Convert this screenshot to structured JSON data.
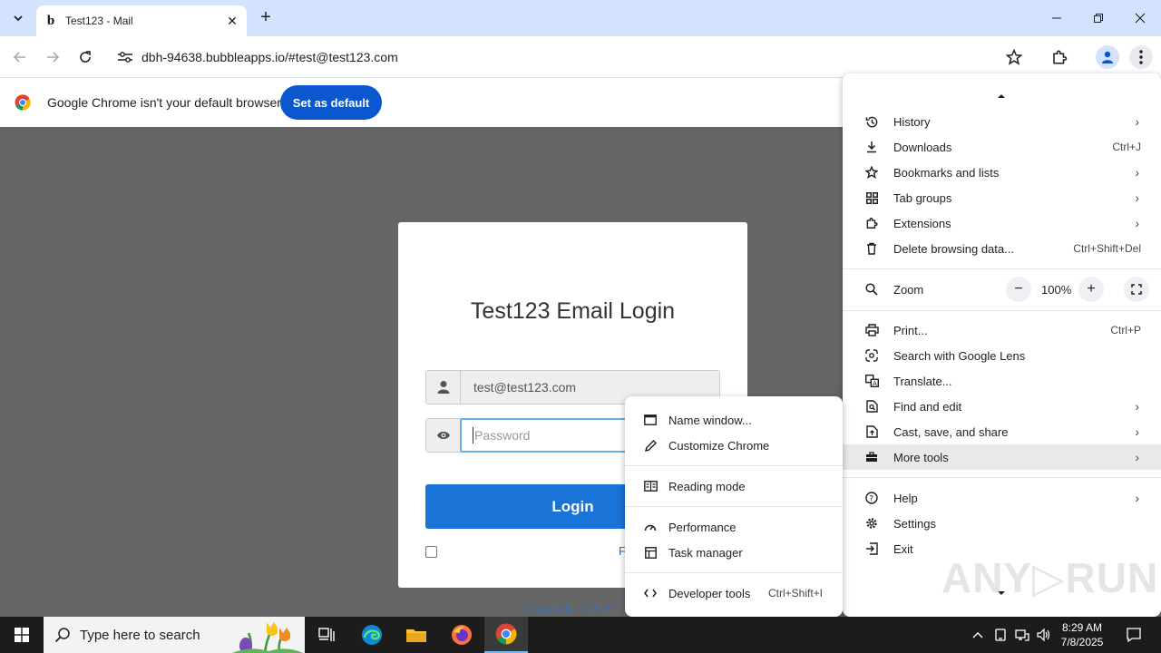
{
  "tab": {
    "title": "Test123 - Mail",
    "favicon": "b"
  },
  "toolbar": {
    "url": "dbh-94638.bubbleapps.io/#test@test123.com"
  },
  "infobar": {
    "message": "Google Chrome isn't your default browser",
    "button": "Set as default"
  },
  "page": {
    "heading": "Test123 Email Login",
    "email_value": "test@test123.com",
    "password_placeholder": "Password",
    "login_label": "Login",
    "forgot_partial": "F",
    "copyright": "Copyright © 2024"
  },
  "menu": {
    "items": [
      {
        "label": "History",
        "icon": "history-icon",
        "submenu": true
      },
      {
        "label": "Downloads",
        "icon": "download-icon",
        "shortcut": "Ctrl+J"
      },
      {
        "label": "Bookmarks and lists",
        "icon": "star-icon",
        "submenu": true
      },
      {
        "label": "Tab groups",
        "icon": "tab-groups-icon",
        "submenu": true
      },
      {
        "label": "Extensions",
        "icon": "puzzle-icon",
        "submenu": true
      },
      {
        "label": "Delete browsing data...",
        "icon": "trash-icon",
        "shortcut": "Ctrl+Shift+Del"
      }
    ],
    "zoom": {
      "label": "Zoom",
      "value": "100%",
      "minus": "−",
      "plus": "+"
    },
    "items2": [
      {
        "label": "Print...",
        "icon": "print-icon",
        "shortcut": "Ctrl+P"
      },
      {
        "label": "Search with Google Lens",
        "icon": "lens-icon"
      },
      {
        "label": "Translate...",
        "icon": "translate-icon"
      },
      {
        "label": "Find and edit",
        "icon": "find-icon",
        "submenu": true
      },
      {
        "label": "Cast, save, and share",
        "icon": "cast-icon",
        "submenu": true
      },
      {
        "label": "More tools",
        "icon": "toolbox-icon",
        "submenu": true,
        "highlighted": true
      }
    ],
    "items3": [
      {
        "label": "Help",
        "icon": "help-icon",
        "submenu": true
      },
      {
        "label": "Settings",
        "icon": "settings-icon"
      },
      {
        "label": "Exit",
        "icon": "exit-icon"
      }
    ]
  },
  "submenu": {
    "items": [
      {
        "label": "Name window...",
        "icon": "window-icon"
      },
      {
        "label": "Customize Chrome",
        "icon": "pen-icon"
      },
      {
        "label": "Reading mode",
        "icon": "reading-mode-icon"
      },
      {
        "label": "Performance",
        "icon": "performance-icon"
      },
      {
        "label": "Task manager",
        "icon": "task-manager-icon"
      },
      {
        "label": "Developer tools",
        "icon": "code-icon",
        "shortcut": "Ctrl+Shift+I"
      }
    ]
  },
  "watermark": "ANY▷RUN",
  "taskbar": {
    "search_placeholder": "Type here to search",
    "time": "8:29 AM",
    "date": "7/8/2025"
  }
}
